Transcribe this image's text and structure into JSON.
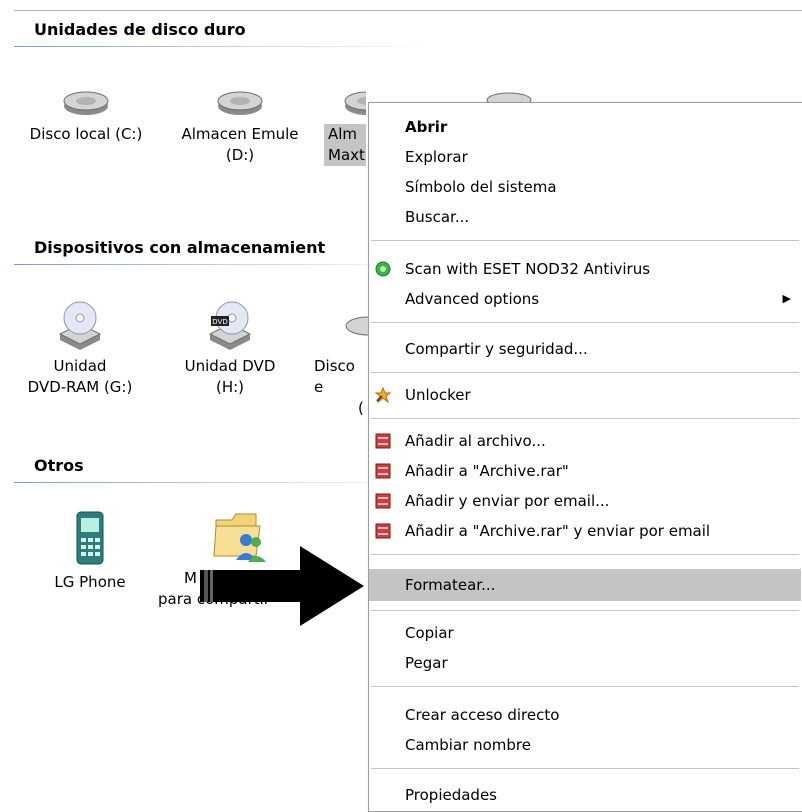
{
  "groups": {
    "hard_disks": {
      "title": "Unidades de disco duro",
      "items": [
        {
          "line1": "Disco local (C:)",
          "line2": ""
        },
        {
          "line1": "Almacen Emule",
          "line2": "(D:)"
        },
        {
          "line1": "Alm",
          "line2": "Maxt"
        },
        {
          "line1": "",
          "line2": ""
        }
      ]
    },
    "removable": {
      "title": "Dispositivos con almacenamient",
      "items": [
        {
          "line1": "Unidad",
          "line2": "DVD-RAM (G:)"
        },
        {
          "line1": "Unidad DVD",
          "line2": "(H:)"
        },
        {
          "line1": "Disco e",
          "line2": "("
        }
      ]
    },
    "others": {
      "title": "Otros",
      "items": [
        {
          "line1": "LG Phone",
          "line2": ""
        },
        {
          "line1": "M",
          "line2": "para compartir"
        }
      ]
    }
  },
  "context_menu": {
    "items": [
      {
        "label": "Abrir"
      },
      {
        "label": "Explorar"
      },
      {
        "label": "Símbolo del sistema"
      },
      {
        "label": "Buscar..."
      },
      {
        "label": "Scan with ESET NOD32 Antivirus",
        "icon": "eset-icon"
      },
      {
        "label": "Advanced options"
      },
      {
        "label": "Compartir y seguridad..."
      },
      {
        "label": "Unlocker",
        "icon": "unlocker-icon"
      },
      {
        "label": "Añadir al archivo...",
        "icon": "winrar-icon"
      },
      {
        "label": "Añadir a \"Archive.rar\"",
        "icon": "winrar-icon"
      },
      {
        "label": "Añadir y enviar por email...",
        "icon": "winrar-icon"
      },
      {
        "label": "Añadir a \"Archive.rar\" y enviar por email",
        "icon": "winrar-icon"
      },
      {
        "label": "Formatear..."
      },
      {
        "label": "Copiar"
      },
      {
        "label": "Pegar"
      },
      {
        "label": "Crear acceso directo"
      },
      {
        "label": "Cambiar nombre"
      },
      {
        "label": "Propiedades"
      }
    ],
    "highlighted": "Formatear...",
    "submenu_arrow": "▶"
  },
  "colors": {
    "selection": "#c4c4c4",
    "winrar_red": "#d23c3c",
    "eset_green": "#3cb44a"
  }
}
